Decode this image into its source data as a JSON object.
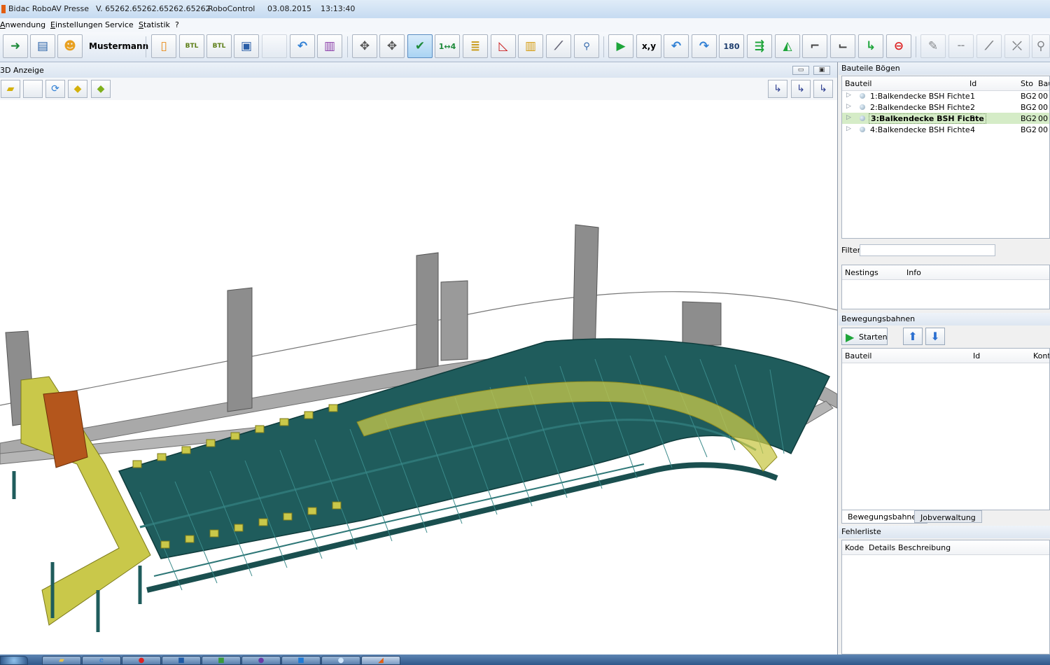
{
  "titlebar": {
    "app_name": "Bidac RoboAV Presse",
    "version": "V. 65262.65262.65262.65262",
    "module": "RoboControl",
    "date": "03.08.2015",
    "time": "13:13:40"
  },
  "menu": {
    "items": [
      {
        "first": "A",
        "rest": "nwendung"
      },
      {
        "first": "E",
        "rest": "instellungen"
      },
      {
        "first": "",
        "rest": "Service"
      },
      {
        "first": "S",
        "rest": "tatistik"
      },
      {
        "first": "",
        "rest": "?"
      }
    ]
  },
  "toolbar": {
    "user_name": "Mustermann",
    "btl_label_1": "BTL",
    "btl_label_2": "BTL",
    "xy_label": "x,y",
    "rotate_label": "180"
  },
  "panel3d": {
    "title": "3D Anzeige",
    "minimize_glyph": "▭",
    "maximize_glyph": "▣"
  },
  "bauteile": {
    "title": "Bauteile Bögen",
    "columns": [
      "Bauteil",
      "Id",
      "Sto",
      "Bau"
    ],
    "rows": [
      {
        "name": "1:Balkendecke BSH Fichte",
        "id": "1",
        "sto": "BG2",
        "bau": "00",
        "selected": false
      },
      {
        "name": "2:Balkendecke BSH Fichte",
        "id": "2",
        "sto": "BG2",
        "bau": "00",
        "selected": false
      },
      {
        "name": "3:Balkendecke BSH Fichte",
        "id": "3",
        "sto": "BG2",
        "bau": "00",
        "selected": true
      },
      {
        "name": "4:Balkendecke BSH Fichte",
        "id": "4",
        "sto": "BG2",
        "bau": "00",
        "selected": false
      }
    ],
    "filter_label": "Filter:",
    "filter_value": ""
  },
  "nestings": {
    "columns": [
      "Nestings",
      "Info"
    ]
  },
  "bewegungsbahnen": {
    "title": "Bewegungsbahnen",
    "start_label": "Starten",
    "columns": [
      "Bauteil",
      "Id",
      "Kont"
    ],
    "tabs": [
      "Bewegungsbahnen",
      "Jobverwaltung"
    ]
  },
  "fehlerliste": {
    "title": "Fehlerliste",
    "columns": [
      "Kode",
      "Details",
      "Beschreibung"
    ]
  },
  "colors": {
    "accent_blue": "#2b6fd0",
    "selection_green": "#d5ecc7",
    "machine_teal": "#1f5c5c",
    "gantry_yellow": "#c9c84a",
    "robot_orange": "#b4561c"
  }
}
